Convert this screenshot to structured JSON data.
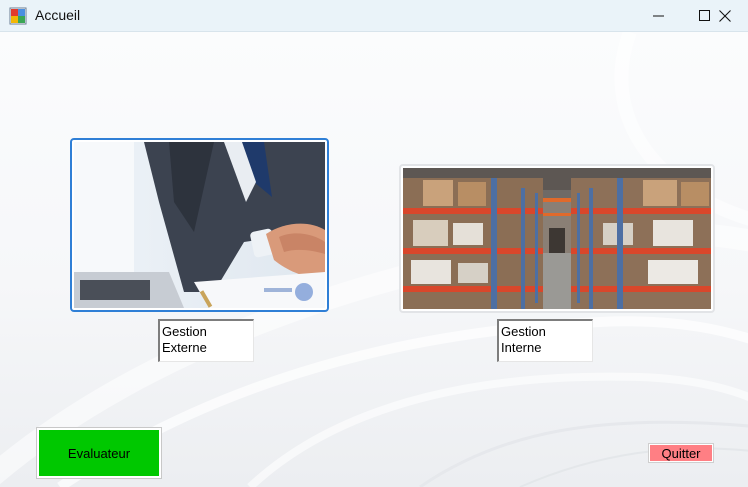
{
  "window": {
    "title": "Accueil",
    "icon": "form-app-icon",
    "controls": [
      "minimize-icon",
      "maximize-icon",
      "close-icon"
    ]
  },
  "options": [
    {
      "label_line1": "Gestion",
      "label_line2": "Externe",
      "image": "handshake-business-photo"
    },
    {
      "label_line1": "Gestion",
      "label_line2": "Interne",
      "image": "warehouse-shelves-photo"
    }
  ],
  "buttons": {
    "evaluateur": "Evaluateur",
    "quitter": "Quitter"
  },
  "colors": {
    "evaluateur_bg": "#00c800",
    "quitter_bg": "#ff7f84",
    "selected_border": "#2f7fd6"
  }
}
